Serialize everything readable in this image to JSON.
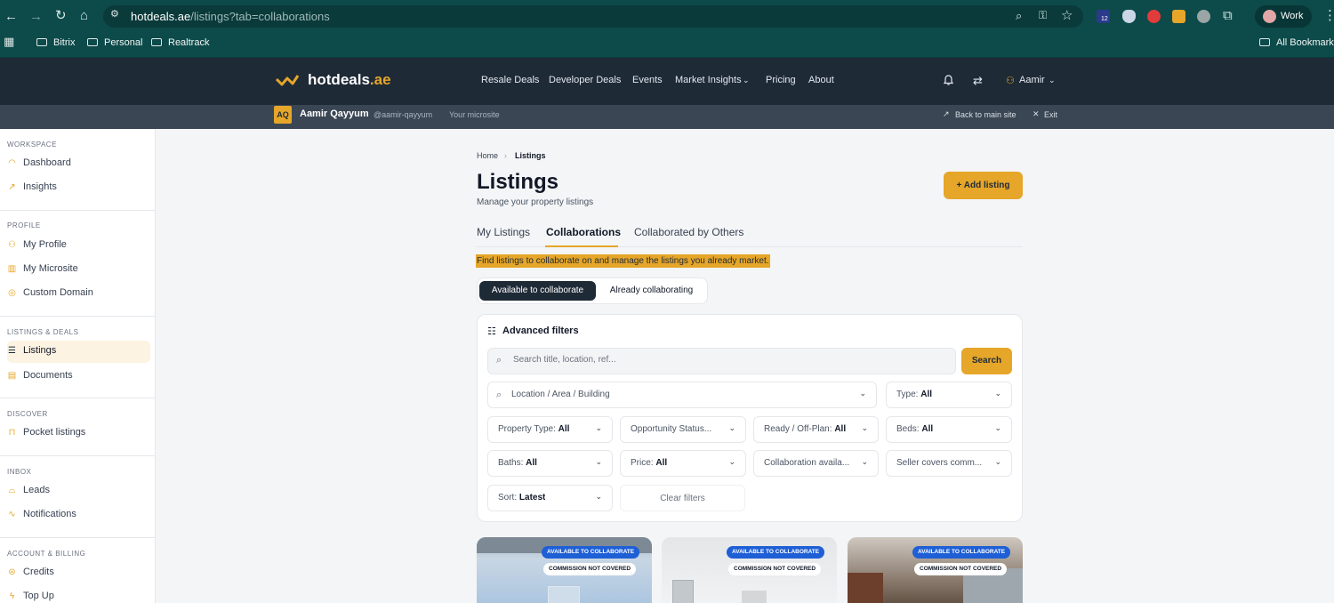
{
  "browser": {
    "url_host": "hotdeals.ae",
    "url_path": "/listings?tab=collaborations",
    "notif_count": "12",
    "profile_label": "Work",
    "bookmarks": [
      "Bitrix",
      "Personal",
      "Realtrack"
    ],
    "all_bookmarks": "All Bookmarks"
  },
  "site": {
    "logo_main": "hotdeals",
    "logo_tld": ".ae",
    "nav": [
      "Resale Deals",
      "Developer Deals",
      "Events",
      "Market Insights",
      "Pricing",
      "About"
    ],
    "user_name": "Aamir"
  },
  "microsite": {
    "initials": "AQ",
    "name": "Aamir Qayyum",
    "handle": "@aamir-qayyum",
    "label": "Your microsite",
    "back": "Back to main site",
    "exit": "Exit"
  },
  "sidebar": {
    "sections": [
      {
        "title": "WORKSPACE",
        "items": [
          "Dashboard",
          "Insights"
        ]
      },
      {
        "title": "PROFILE",
        "items": [
          "My Profile",
          "My Microsite",
          "Custom Domain"
        ]
      },
      {
        "title": "LISTINGS & DEALS",
        "items": [
          "Listings",
          "Documents"
        ]
      },
      {
        "title": "DISCOVER",
        "items": [
          "Pocket listings"
        ]
      },
      {
        "title": "INBOX",
        "items": [
          "Leads",
          "Notifications"
        ]
      },
      {
        "title": "ACCOUNT & BILLING",
        "items": [
          "Credits",
          "Top Up"
        ]
      }
    ],
    "active": "Listings"
  },
  "main": {
    "breadcrumb": [
      "Home",
      "Listings"
    ],
    "title": "Listings",
    "subtitle": "Manage your property listings",
    "add_button": "+ Add listing",
    "tabs": [
      "My Listings",
      "Collaborations",
      "Collaborated by Others"
    ],
    "active_tab": "Collaborations",
    "helper_text": "Find listings to collaborate on and manage the listings you already market.",
    "toggle": [
      "Available to collaborate",
      "Already collaborating"
    ]
  },
  "filters": {
    "title": "Advanced filters",
    "search_placeholder": "Search title, location, ref...",
    "search_button": "Search",
    "location_placeholder": "Location / Area / Building",
    "type": {
      "label": "Type:",
      "value": "All"
    },
    "property_type": {
      "label": "Property Type:",
      "value": "All"
    },
    "opportunity_status": {
      "label": "Opportunity Status...",
      "value": ""
    },
    "ready_offplan": {
      "label": "Ready / Off-Plan:",
      "value": "All"
    },
    "beds": {
      "label": "Beds:",
      "value": "All"
    },
    "baths": {
      "label": "Baths:",
      "value": "All"
    },
    "price": {
      "label": "Price:",
      "value": "All"
    },
    "collaboration": {
      "label": "Collaboration availa...",
      "value": ""
    },
    "seller_covers": {
      "label": "Seller covers comm...",
      "value": ""
    },
    "sort": {
      "label": "Sort:",
      "value": "Latest"
    },
    "clear": "Clear filters"
  },
  "cards": [
    {
      "badge1": "AVAILABLE TO COLLABORATE",
      "badge2": "COMMISSION NOT COVERED"
    },
    {
      "badge1": "AVAILABLE TO COLLABORATE",
      "badge2": "COMMISSION NOT COVERED"
    },
    {
      "badge1": "AVAILABLE TO COLLABORATE",
      "badge2": "COMMISSION NOT COVERED"
    }
  ]
}
